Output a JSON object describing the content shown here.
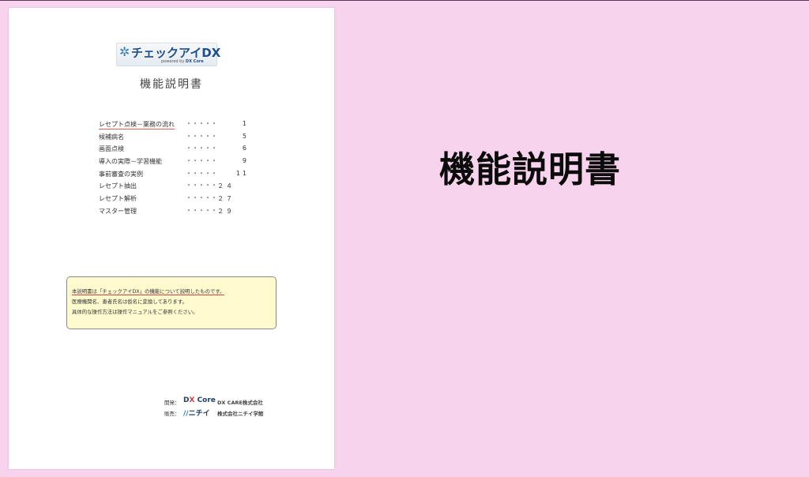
{
  "logo": {
    "name": "チェックアイDX",
    "sub_prefix": "powered by",
    "sub_brand": "DX Core"
  },
  "doc_title": "機能説明書",
  "toc": [
    {
      "label": "レセプト点検－業務の流れ",
      "dots": "・・・・・",
      "page": "1"
    },
    {
      "label": "候補病名",
      "dots": "・・・・・",
      "page": "5"
    },
    {
      "label": "画面点検",
      "dots": "・・・・・",
      "page": "6"
    },
    {
      "label": "導入の実際－学習機能",
      "dots": "・・・・・",
      "page": "9"
    },
    {
      "label": "事前審査の実例",
      "dots": "・・・・・",
      "page": "11"
    },
    {
      "label": "レセプト抽出",
      "dots": "・・・・・",
      "page": "２４"
    },
    {
      "label": "レセプト解析",
      "dots": "・・・・・",
      "page": "２７"
    },
    {
      "label": "マスター管理",
      "dots": "・・・・・",
      "page": "２９"
    }
  ],
  "note": {
    "line1": "本説明書は「チェックアイDX」の機能について説明したものです。",
    "line2": "医療機関名、患者氏名は仮名に変換してあります。",
    "line3": "具体的な操作方法は操作マニュアルをご参照ください。"
  },
  "credits": {
    "dev_key": "開発：",
    "dev_brand_a": "D",
    "dev_brand_b": "X",
    "dev_brand_c": " Core",
    "dev_company": "DX CARE株式会社",
    "sales_key": "販売：",
    "sales_brand_mark": "//",
    "sales_brand": "ニチイ",
    "sales_company": "株式会社ニチイ学館"
  },
  "big_title": "機能説明書",
  "colors": {
    "background": "#f7d3ee",
    "note_box": "#fffbcf",
    "brand_blue": "#1f4e8c"
  }
}
